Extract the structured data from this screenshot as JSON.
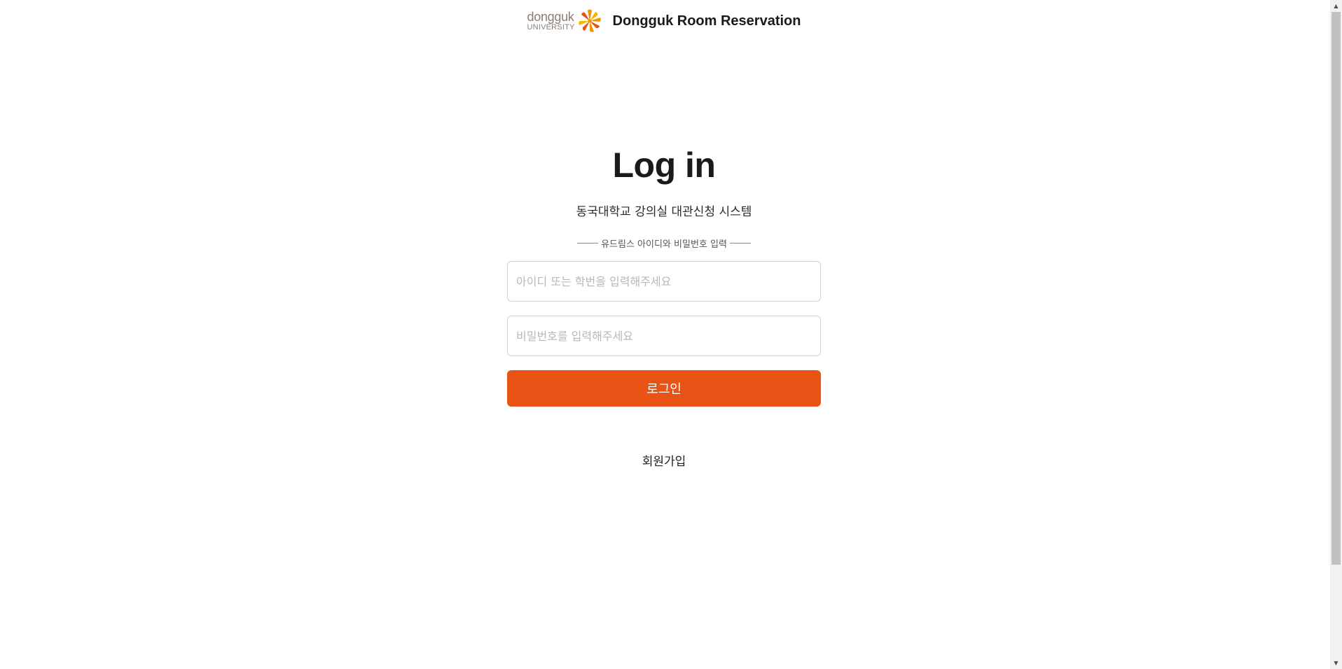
{
  "header": {
    "logo": {
      "word": "dongguk",
      "sub": "UNIVERSITY",
      "icon": "dongguk-flower-logo"
    },
    "title": "Dongguk Room Reservation"
  },
  "login": {
    "title": "Log in",
    "subtitle": "동국대학교 강의실 대관신청 시스템",
    "divider_text": "유드림스 아이디와 비밀번호 입력",
    "id_placeholder": "아이디 또는 학번을 입력해주세요",
    "id_value": "",
    "password_placeholder": "비밀번호를 입력해주세요",
    "password_value": "",
    "submit_label": "로그인",
    "signup_label": "회원가입"
  },
  "colors": {
    "accent": "#e85416",
    "logo_text": "#8a7d74",
    "logo_orange": "#f39200",
    "logo_red": "#e8531d"
  },
  "scrollbar": {
    "up_icon": "triangle-up-icon",
    "down_icon": "triangle-down-icon"
  }
}
